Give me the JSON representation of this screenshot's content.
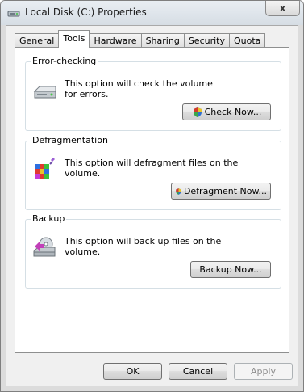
{
  "window": {
    "title": "Local Disk (C:) Properties",
    "close_glyph": "x"
  },
  "tabs": [
    {
      "label": "General"
    },
    {
      "label": "Tools",
      "active": true
    },
    {
      "label": "Hardware"
    },
    {
      "label": "Sharing"
    },
    {
      "label": "Security"
    },
    {
      "label": "Quota"
    }
  ],
  "groups": {
    "error_checking": {
      "label": "Error-checking",
      "description": "This option will check the volume for errors.",
      "button": "Check Now...",
      "icon": "hard-drive-icon"
    },
    "defragmentation": {
      "label": "Defragmentation",
      "description": "This option will defragment files on the volume.",
      "button": "Defragment Now...",
      "icon": "defrag-icon"
    },
    "backup": {
      "label": "Backup",
      "description": "This option will back up files on the volume.",
      "button": "Backup Now...",
      "icon": "backup-icon"
    }
  },
  "footer": {
    "ok": "OK",
    "cancel": "Cancel",
    "apply": "Apply"
  }
}
